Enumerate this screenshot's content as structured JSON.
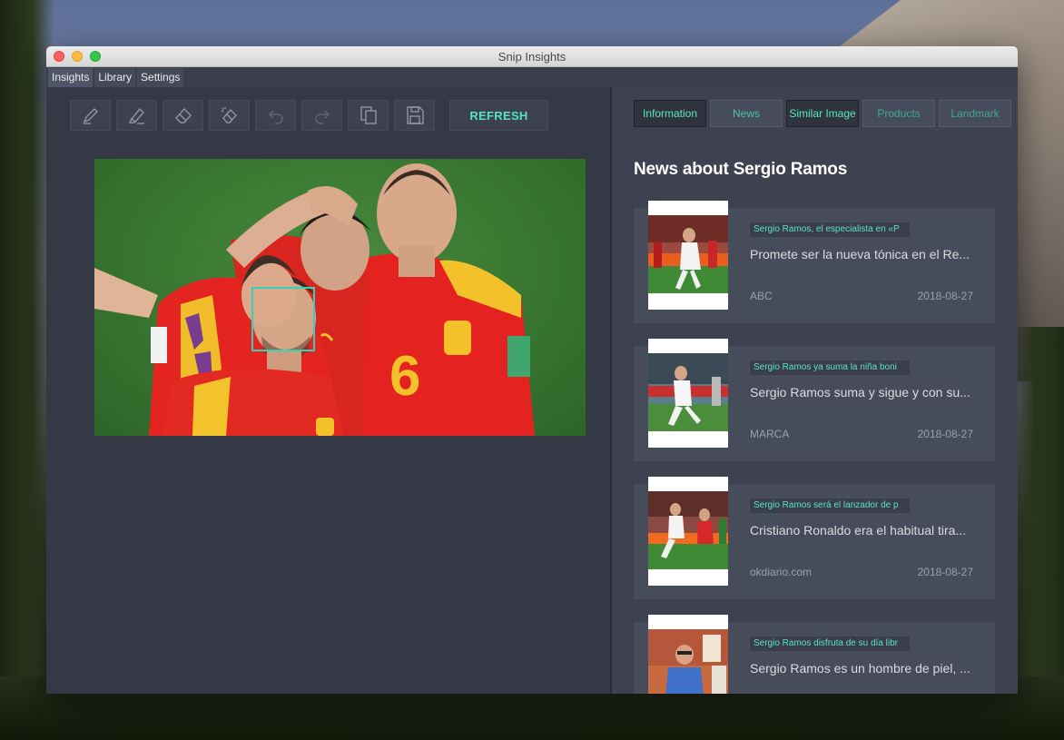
{
  "window": {
    "title": "Snip Insights"
  },
  "tabs": [
    {
      "label": "Insights"
    },
    {
      "label": "Library"
    },
    {
      "label": "Settings"
    }
  ],
  "toolbar": {
    "tools": [
      "pen-icon",
      "highlighter-icon",
      "eraser-icon",
      "clear-all-icon",
      "undo-icon",
      "redo-icon",
      "copy-icon",
      "save-icon"
    ],
    "refresh_label": "REFRESH"
  },
  "insight_tabs": [
    {
      "label": "Information"
    },
    {
      "label": "News"
    },
    {
      "label": "Similar Image"
    },
    {
      "label": "Products"
    },
    {
      "label": "Landmark"
    }
  ],
  "news": {
    "heading": "News about Sergio Ramos",
    "items": [
      {
        "title": "Sergio Ramos, el especialista en «P",
        "description": "Promete ser la nueva tónica en el Re...",
        "source": "ABC",
        "date": "2018-08-27"
      },
      {
        "title": "Sergio Ramos ya suma la niña boni",
        "description": "Sergio Ramos suma y sigue y con su...",
        "source": "MARCA",
        "date": "2018-08-27"
      },
      {
        "title": "Sergio Ramos será el lanzador de p",
        "description": "Cristiano Ronaldo era el habitual tira...",
        "source": "okdiario.com",
        "date": "2018-08-27"
      },
      {
        "title": "Sergio Ramos disfruta de su día libr",
        "description": "Sergio Ramos es un hombre de piel, ...",
        "source": "",
        "date": ""
      }
    ]
  },
  "colors": {
    "accent": "#54e3c0",
    "panel_bg": "#353945",
    "face_box": "#35d3b5"
  }
}
